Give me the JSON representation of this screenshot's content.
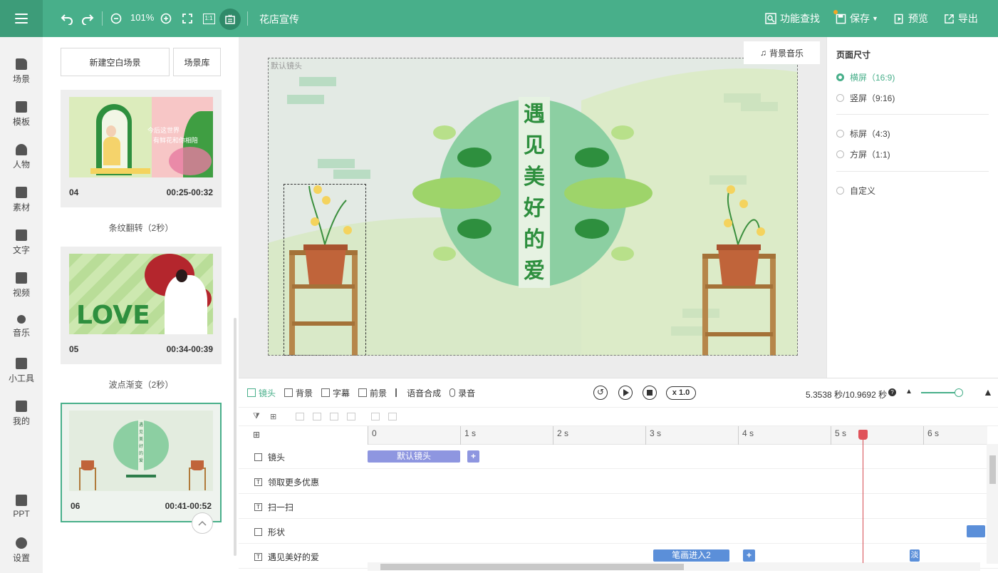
{
  "toolbar": {
    "zoom": "101%",
    "project_title": "花店宣传",
    "func_search": "功能查找",
    "save": "保存",
    "preview": "预览",
    "export": "导出",
    "fit_label": "1:1"
  },
  "leftnav": [
    {
      "label": "场景"
    },
    {
      "label": "模板"
    },
    {
      "label": "人物"
    },
    {
      "label": "素材"
    },
    {
      "label": "文字"
    },
    {
      "label": "视频"
    },
    {
      "label": "音乐"
    },
    {
      "label": "小工具"
    },
    {
      "label": "我的"
    },
    {
      "label": "PPT"
    },
    {
      "label": "设置"
    }
  ],
  "scene_panel": {
    "new_blank": "新建空白场景",
    "library": "场景库",
    "scenes": [
      {
        "num": "04",
        "time": "00:25-00:32",
        "transition": "条纹翻转（2秒）",
        "thumb_text1": "今后这世界",
        "thumb_text2": "有鲜花和你相陪"
      },
      {
        "num": "05",
        "time": "00:34-00:39",
        "transition": "波点渐变（2秒）",
        "thumb_text1": "LOVE"
      },
      {
        "num": "06",
        "time": "00:41-00:52",
        "thumb_text1": "遇见美好的爱"
      }
    ]
  },
  "canvas": {
    "camera_label": "默认镜头",
    "bg_music": "背景音乐",
    "title_chars": [
      "遇",
      "见",
      "美",
      "好",
      "的",
      "爱"
    ]
  },
  "props": {
    "heading": "页面尺寸",
    "options": [
      {
        "label": "横屏（16:9)",
        "selected": true
      },
      {
        "label": "竖屏（9:16)",
        "selected": false
      },
      {
        "label": "标屏（4:3)",
        "selected": false
      },
      {
        "label": "方屏（1:1)",
        "selected": false
      },
      {
        "label": "自定义",
        "selected": false
      }
    ]
  },
  "timeline": {
    "tabs": [
      "镜头",
      "背景",
      "字幕",
      "前景",
      "语音合成",
      "录音"
    ],
    "speed": "x 1.0",
    "time_readout": "5.3538 秒/10.9692 秒",
    "ruler": [
      "0",
      "1 s",
      "2 s",
      "3 s",
      "4 s",
      "5 s",
      "6 s"
    ],
    "rows": [
      {
        "label": "镜头",
        "clip": "默认镜头"
      },
      {
        "label": "领取更多优惠"
      },
      {
        "label": "扫一扫"
      },
      {
        "label": "形状"
      },
      {
        "label": "遇见美好的爱",
        "clip": "笔画进入2",
        "clip2": "淡"
      }
    ]
  },
  "colors": {
    "brand": "#48af8a",
    "clip_purple": "#8e96e0",
    "clip_blue": "#5b8fd9",
    "playhead": "#d4474e"
  }
}
